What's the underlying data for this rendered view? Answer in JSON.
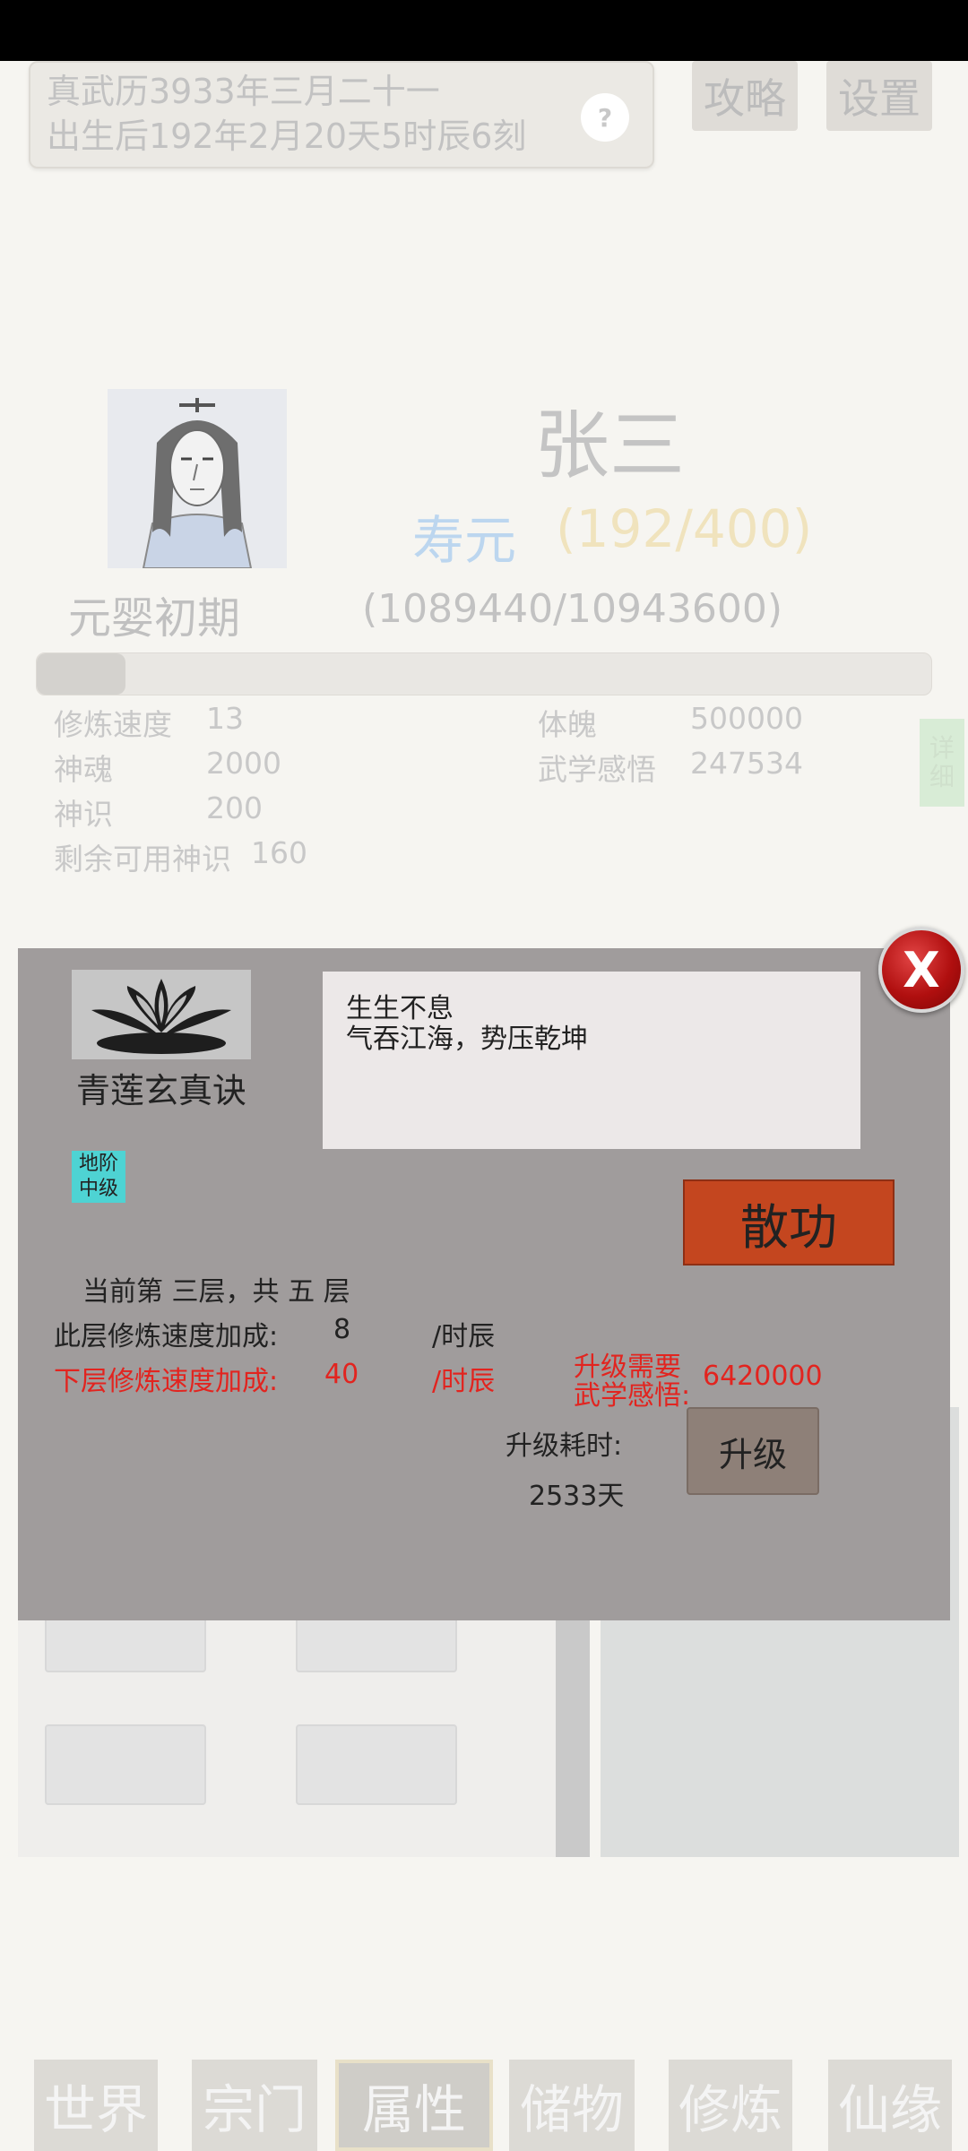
{
  "header": {
    "date_line1": "真武历3933年三月二十一",
    "date_line2": "出生后192年2月20天5时辰6刻",
    "help_label": "?",
    "guide_label": "攻略",
    "settings_label": "设置"
  },
  "character": {
    "name": "张三",
    "lifespan_label": "寿元",
    "lifespan_value": "(192/400)",
    "realm": "元婴初期",
    "cultivation_progress": "(1089440/10943600)",
    "progress_fraction": 0.0995
  },
  "stats": {
    "left": [
      {
        "label": "修炼速度",
        "value": "13"
      },
      {
        "label": "神魂",
        "value": "2000"
      },
      {
        "label": "神识",
        "value": "200"
      },
      {
        "label": "剩余可用神识",
        "value": "160"
      }
    ],
    "right": [
      {
        "label": "体魄",
        "value": "500000"
      },
      {
        "label": "武学感悟",
        "value": "247534"
      }
    ],
    "detail_line1": "详",
    "detail_line2": "细"
  },
  "modal": {
    "skill_name": "青莲玄真诀",
    "grade_line1": "地阶",
    "grade_line2": "中级",
    "desc_line1": "生生不息",
    "desc_line2": "气吞江海，势压乾坤",
    "disperse_label": "散功",
    "current_layer": "当前第 三层，共 五 层",
    "this_layer_label": "此层修炼速度加成:",
    "this_layer_value": "8",
    "this_layer_unit": "/时辰",
    "next_layer_label": "下层修炼速度加成:",
    "next_layer_value": "40",
    "next_layer_unit": "/时辰",
    "upgrade_need_line1": "升级需要",
    "upgrade_need_line2": "武学感悟:",
    "upgrade_need_value": "6420000",
    "upgrade_time_label": "升级耗时:",
    "upgrade_time_value": "2533天",
    "upgrade_button": "升级",
    "close_label": "X"
  },
  "bottom_nav": [
    "世界",
    "宗门",
    "属性",
    "储物",
    "修炼",
    "仙缘"
  ],
  "colors": {
    "modal_bg": "#a09c9c",
    "disperse_button": "#c4461f",
    "close_button": "#b00f0f",
    "grade_badge": "#4ed3d3",
    "highlight_text": "#e2241f"
  }
}
